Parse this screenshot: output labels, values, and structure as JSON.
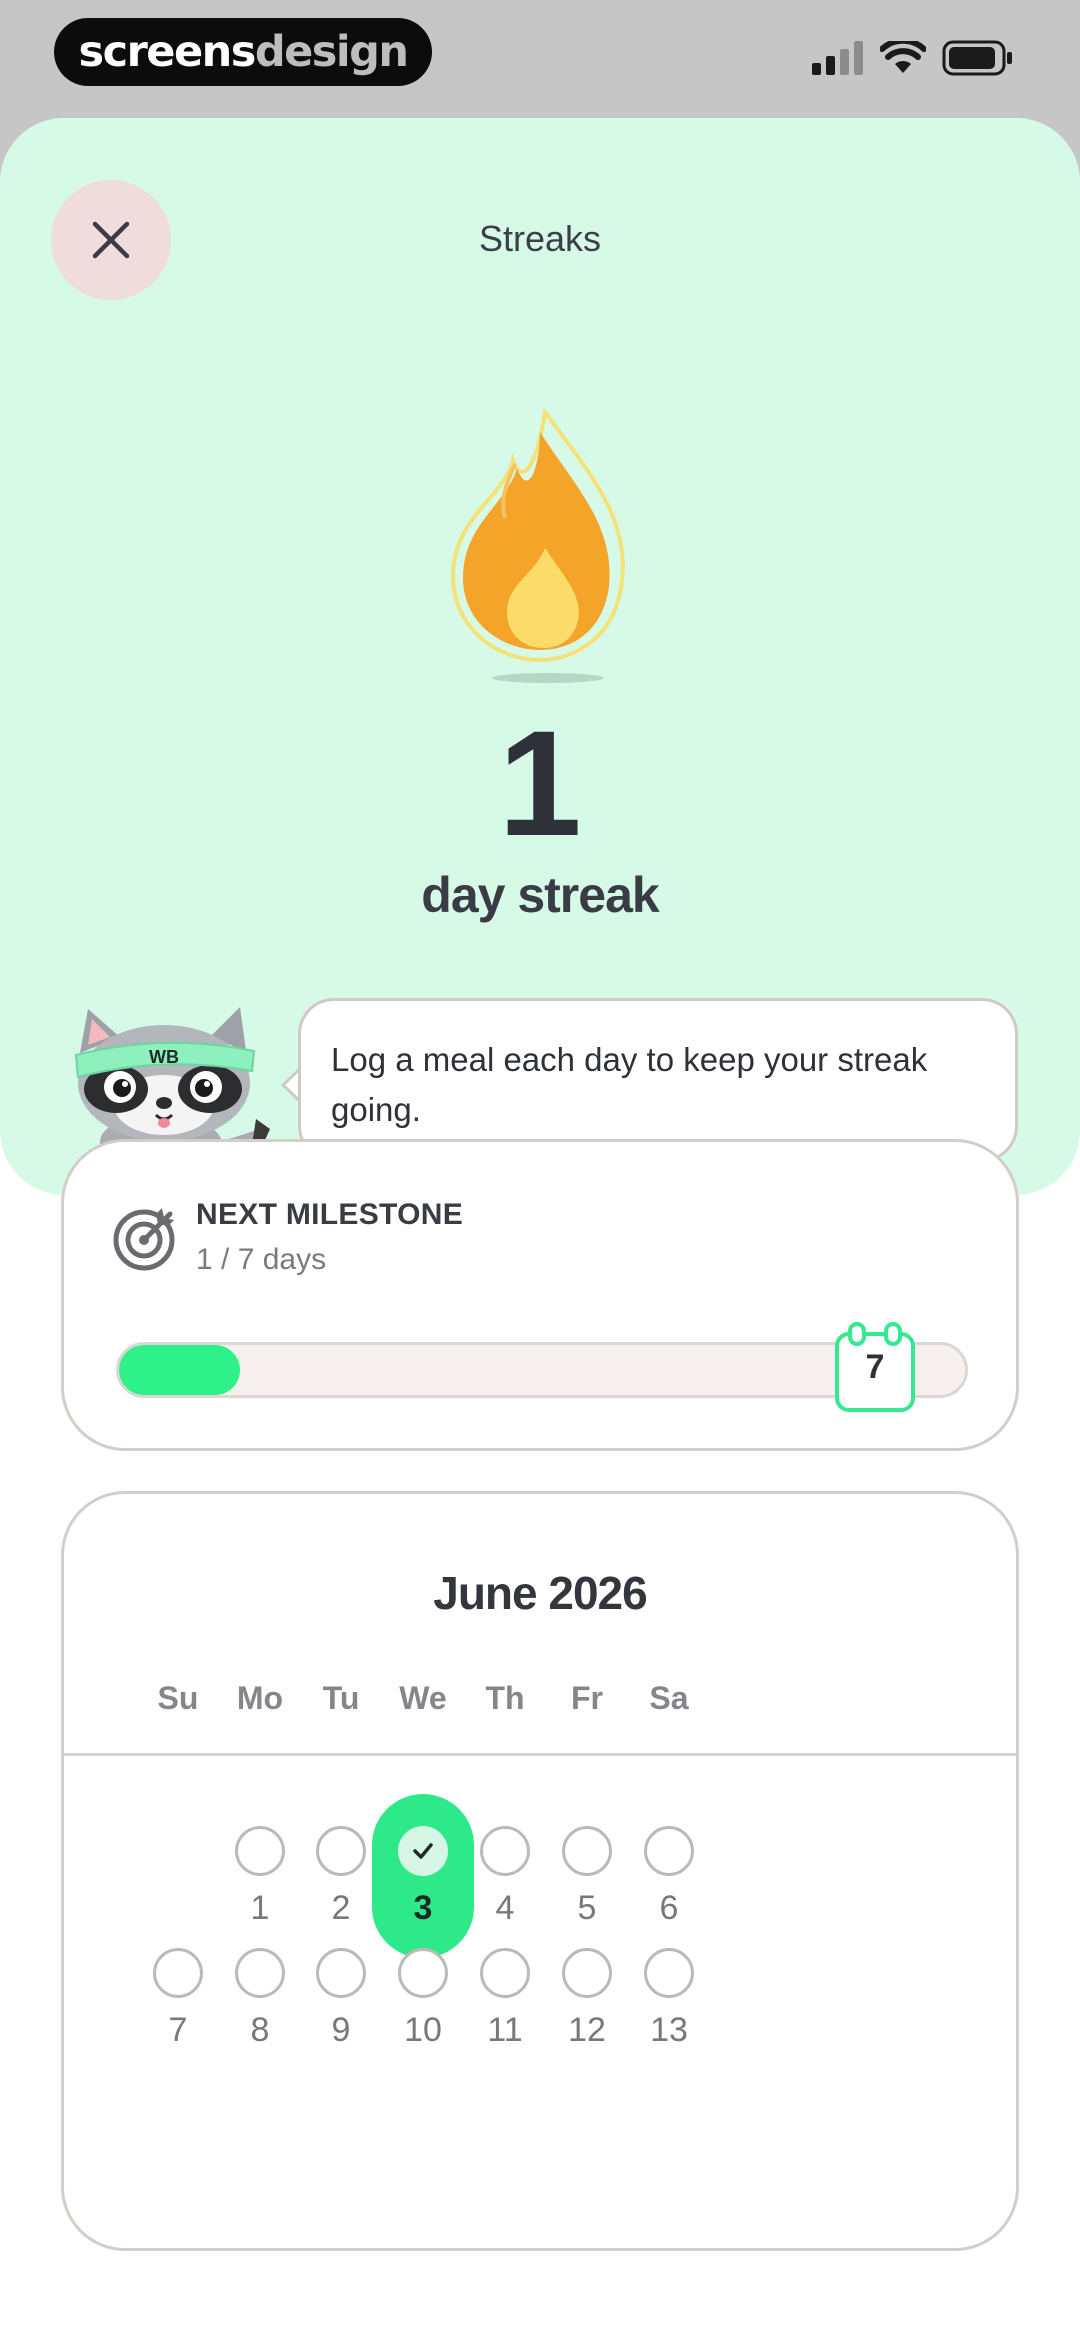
{
  "status_bar": {
    "brand_part1": "screens",
    "brand_part2": "design",
    "icons": [
      "signal-icon",
      "wifi-icon",
      "battery-icon"
    ]
  },
  "header": {
    "title": "Streaks",
    "close_icon": "close-icon"
  },
  "streak": {
    "count": "1",
    "label": "day streak",
    "tip": "Log a meal each day to keep your streak going.",
    "mascot_badge": "WB"
  },
  "milestone": {
    "title": "NEXT MILESTONE",
    "subtitle": "1 / 7 days",
    "goal": "7",
    "progress_fraction": 0.143
  },
  "calendar": {
    "title": "June 2026",
    "weekdays": [
      "Su",
      "Mo",
      "Tu",
      "We",
      "Th",
      "Fr",
      "Sa"
    ],
    "weeks": [
      [
        "",
        "1",
        "2",
        "3",
        "4",
        "5",
        "6"
      ],
      [
        "7",
        "8",
        "9",
        "10",
        "11",
        "12",
        "13"
      ]
    ],
    "completed_days": [
      "3"
    ],
    "today": "3"
  },
  "colors": {
    "accent_green": "#2ef18a",
    "hero_bg": "#d7f9e8",
    "close_bg": "#f0dcdc",
    "flame_orange": "#f5a623"
  }
}
